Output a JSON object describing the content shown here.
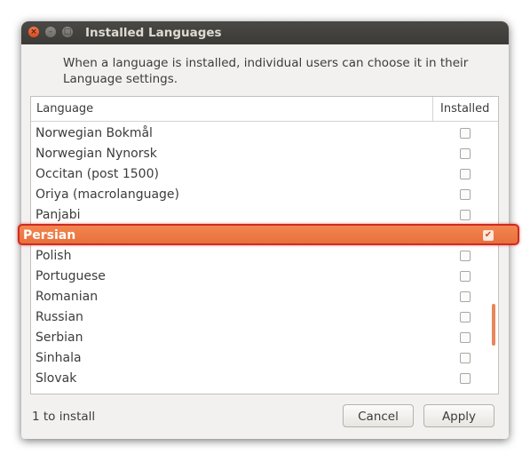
{
  "window": {
    "title": "Installed Languages",
    "controls": {
      "close": "×",
      "minimize": "–",
      "maximize": "□"
    }
  },
  "description": "When a language is installed, individual users can choose it in their Language settings.",
  "list": {
    "columns": {
      "language": "Language",
      "installed": "Installed"
    },
    "rows": [
      {
        "name": "Norwegian Bokmål",
        "installed": false
      },
      {
        "name": "Norwegian Nynorsk",
        "installed": false
      },
      {
        "name": "Occitan (post 1500)",
        "installed": false
      },
      {
        "name": "Oriya (macrolanguage)",
        "installed": false
      },
      {
        "name": "Panjabi",
        "installed": false
      },
      {
        "name": "Persian",
        "installed": true,
        "selected": true
      },
      {
        "name": "Polish",
        "installed": false
      },
      {
        "name": "Portuguese",
        "installed": false
      },
      {
        "name": "Romanian",
        "installed": false
      },
      {
        "name": "Russian",
        "installed": false
      },
      {
        "name": "Serbian",
        "installed": false
      },
      {
        "name": "Sinhala",
        "installed": false
      },
      {
        "name": "Slovak",
        "installed": false
      }
    ],
    "selected_checkmark": "✔"
  },
  "footer": {
    "status": "1 to install",
    "cancel_label": "Cancel",
    "apply_label": "Apply"
  },
  "colors": {
    "selection": "#ef7c45",
    "highlight_border": "#d02a22",
    "close_button": "#e9562a"
  }
}
